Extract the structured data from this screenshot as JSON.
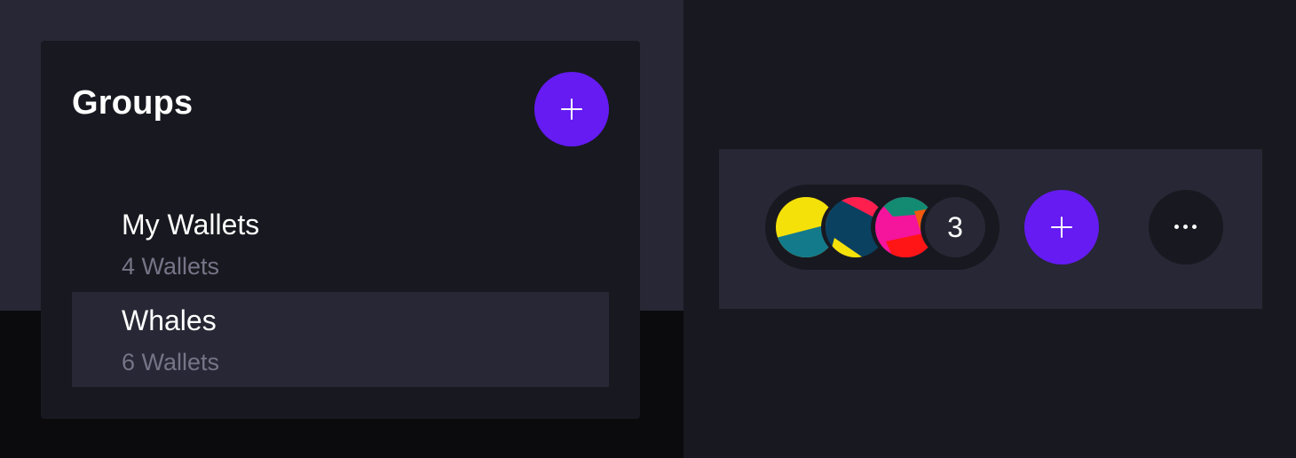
{
  "groups_panel": {
    "title": "Groups",
    "add_button_icon": "plus-icon",
    "items": [
      {
        "name": "My Wallets",
        "count_label": "4 Wallets",
        "selected": false
      },
      {
        "name": "Whales",
        "count_label": "6 Wallets",
        "selected": true
      }
    ]
  },
  "toolbar": {
    "avatars": [
      {
        "icon": "wallet-avatar-icon",
        "colors": [
          "#f5e10a",
          "#137a8c"
        ]
      },
      {
        "icon": "wallet-avatar-icon",
        "colors": [
          "#0b4160",
          "#ff1f4f",
          "#f5e10a",
          "#1777cf"
        ]
      },
      {
        "icon": "wallet-avatar-icon",
        "colors": [
          "#f5149c",
          "#128b72",
          "#ff1515",
          "#f15a0f"
        ]
      }
    ],
    "count": "3",
    "add_button_icon": "plus-icon",
    "more_button_icon": "more-horizontal-icon"
  },
  "colors": {
    "accent": "#651bf2",
    "panel": "#181820",
    "surface": "#272735",
    "muted_text": "#777487"
  }
}
